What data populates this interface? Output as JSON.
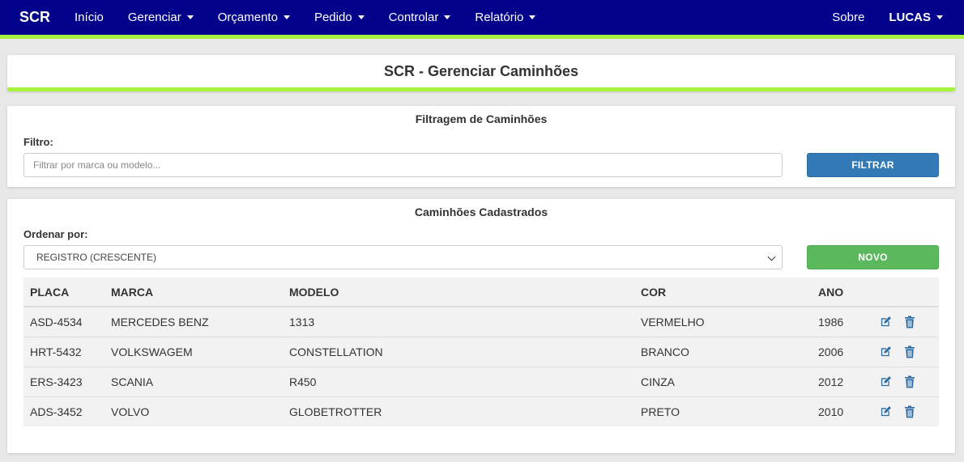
{
  "nav": {
    "brand": "SCR",
    "items": [
      {
        "label": "Início",
        "dropdown": false
      },
      {
        "label": "Gerenciar",
        "dropdown": true
      },
      {
        "label": "Orçamento",
        "dropdown": true
      },
      {
        "label": "Pedido",
        "dropdown": true
      },
      {
        "label": "Controlar",
        "dropdown": true
      },
      {
        "label": "Relatório",
        "dropdown": true
      }
    ],
    "about": "Sobre",
    "user": "LUCAS"
  },
  "page_title": "SCR - Gerenciar Caminhões",
  "filter": {
    "section_title": "Filtragem de Caminhões",
    "label": "Filtro:",
    "placeholder": "Filtrar por marca ou modelo...",
    "button": "FILTRAR"
  },
  "list": {
    "section_title": "Caminhões Cadastrados",
    "order_label": "Ordenar por:",
    "order_selected": "REGISTRO (CRESCENTE)",
    "new_button": "NOVO",
    "columns": [
      "PLACA",
      "MARCA",
      "MODELO",
      "COR",
      "ANO"
    ],
    "rows": [
      {
        "placa": "ASD-4534",
        "marca": "MERCEDES BENZ",
        "modelo": "1313",
        "cor": "VERMELHO",
        "ano": "1986"
      },
      {
        "placa": "HRT-5432",
        "marca": "VOLKSWAGEM",
        "modelo": "CONSTELLATION",
        "cor": "BRANCO",
        "ano": "2006"
      },
      {
        "placa": "ERS-3423",
        "marca": "SCANIA",
        "modelo": "R450",
        "cor": "CINZA",
        "ano": "2012"
      },
      {
        "placa": "ADS-3452",
        "marca": "VOLVO",
        "modelo": "GLOBETROTTER",
        "cor": "PRETO",
        "ano": "2010"
      }
    ],
    "row_actions": [
      "edit-icon",
      "trash-icon"
    ]
  },
  "colors": {
    "navbar": "#02028b",
    "accent": "#a6f23c",
    "primary_button": "#337ab7",
    "success_button": "#5cb85c"
  }
}
